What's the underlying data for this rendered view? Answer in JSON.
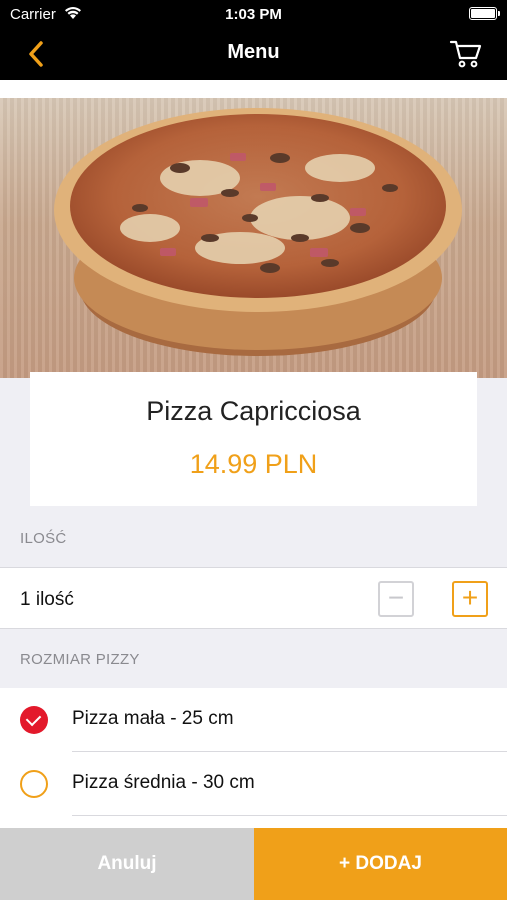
{
  "status_bar": {
    "carrier": "Carrier",
    "time": "1:03 PM"
  },
  "nav": {
    "title": "Menu",
    "back_icon": "chevron-left-icon",
    "cart_icon": "cart-icon"
  },
  "product": {
    "name": "Pizza Capricciosa",
    "price": "14.99 PLN"
  },
  "quantity": {
    "section_label": "ILOŚĆ",
    "value_text": "1 ilość",
    "minus_glyph": "−",
    "plus_glyph": "+"
  },
  "size": {
    "section_label": "ROZMIAR PIZZY",
    "options": [
      {
        "label": "Pizza mała - 25 cm",
        "selected": true
      },
      {
        "label": "Pizza średnia - 30 cm",
        "selected": false
      }
    ]
  },
  "actions": {
    "cancel_label": "Anuluj",
    "add_label": "+ DODAJ"
  },
  "colors": {
    "accent": "#f0a019",
    "selected": "#e3192b",
    "nav_bg": "#000000"
  }
}
